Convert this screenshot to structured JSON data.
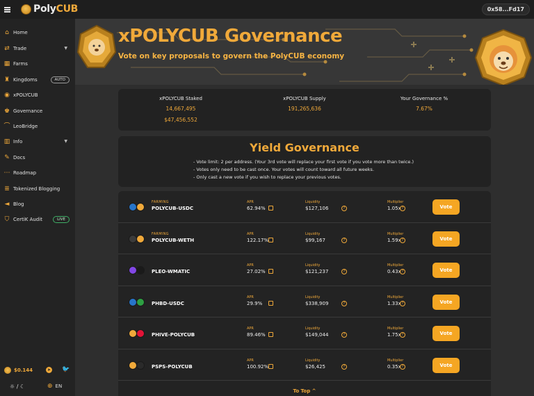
{
  "header": {
    "brand_prefix": "Poly",
    "brand_suffix": "CUB",
    "wallet": "0x58...Fd17"
  },
  "sidebar": {
    "items": [
      {
        "label": "Home",
        "icon": "home-icon"
      },
      {
        "label": "Trade",
        "icon": "trade-icon"
      },
      {
        "label": "Farms",
        "icon": "farms-icon"
      },
      {
        "label": "Kingdoms",
        "icon": "kingdoms-icon",
        "badge": "AUTO"
      },
      {
        "label": "xPOLYCUB",
        "icon": "xpolycub-icon"
      },
      {
        "label": "Governance",
        "icon": "governance-icon"
      },
      {
        "label": "LeoBridge",
        "icon": "leobridge-icon"
      },
      {
        "label": "Info",
        "icon": "info-icon"
      },
      {
        "label": "Docs",
        "icon": "docs-icon"
      },
      {
        "label": "Roadmap",
        "icon": "roadmap-icon"
      },
      {
        "label": "Tokenized Blogging",
        "icon": "blogging-icon"
      },
      {
        "label": "Blog",
        "icon": "blog-icon"
      },
      {
        "label": "CertiK Audit",
        "icon": "certik-icon",
        "badge": "LIVE"
      }
    ],
    "price": "$0.144",
    "language": "EN"
  },
  "hero": {
    "title": "xPOLYCUB Governance",
    "subtitle": "Vote on key proposals to govern the PolyCUB economy"
  },
  "stats": [
    {
      "label": "xPOLYCUB Staked",
      "values": [
        "14,667,495",
        "$47,456,552"
      ]
    },
    {
      "label": "xPOLYCUB Supply",
      "values": [
        "191,265,636"
      ]
    },
    {
      "label": "Your Governance %",
      "values": [
        "7.67%"
      ]
    }
  ],
  "yield": {
    "title": "Yield Governance",
    "rules": [
      "- Vote limit: 2 per address. (Your 3rd vote will replace your first vote if you vote more than twice.)",
      "- Votes only need to be cast once. Your votes will count toward all future weeks.",
      "- Only cast a new vote if you wish to replace your previous votes."
    ]
  },
  "farm_columns": {
    "farming": "FARMING",
    "apr": "APR",
    "liquidity": "Liquidity",
    "multiplier": "Multiplier"
  },
  "farms": [
    {
      "pair": "POLYCUB-USDC",
      "tag": "FARMING",
      "apr": "62.94%",
      "liquidity": "$127,106",
      "multiplier": "1.05x",
      "vote": "Vote",
      "tok1": "#2775ca",
      "tok2": "#f0a93a"
    },
    {
      "pair": "POLYCUB-WETH",
      "tag": "FARMING",
      "apr": "122.17%",
      "liquidity": "$99,167",
      "multiplier": "1.59x",
      "vote": "Vote",
      "tok1": "#3b3b3b",
      "tok2": "#f0a93a"
    },
    {
      "pair": "PLEO-WMATIC",
      "tag": "",
      "apr": "27.02%",
      "liquidity": "$121,237",
      "multiplier": "0.43x",
      "vote": "Vote",
      "tok1": "#8247e5",
      "tok2": "#1a1a1a"
    },
    {
      "pair": "PHBD-USDC",
      "tag": "",
      "apr": "29.9%",
      "liquidity": "$338,909",
      "multiplier": "1.33x",
      "vote": "Vote",
      "tok1": "#2775ca",
      "tok2": "#2ea043"
    },
    {
      "pair": "PHIVE-POLYCUB",
      "tag": "",
      "apr": "89.46%",
      "liquidity": "$149,044",
      "multiplier": "1.75x",
      "vote": "Vote",
      "tok1": "#f0a93a",
      "tok2": "#e31337"
    },
    {
      "pair": "PSPS-POLYCUB",
      "tag": "",
      "apr": "100.92%",
      "liquidity": "$26,425",
      "multiplier": "0.35x",
      "vote": "Vote",
      "tok1": "#f0a93a",
      "tok2": "#2a2a2a"
    }
  ],
  "to_top": "To Top ^",
  "colors": {
    "accent": "#f0a93a",
    "button": "#f5a623",
    "bg": "#2e2e2e",
    "card": "#222222"
  }
}
